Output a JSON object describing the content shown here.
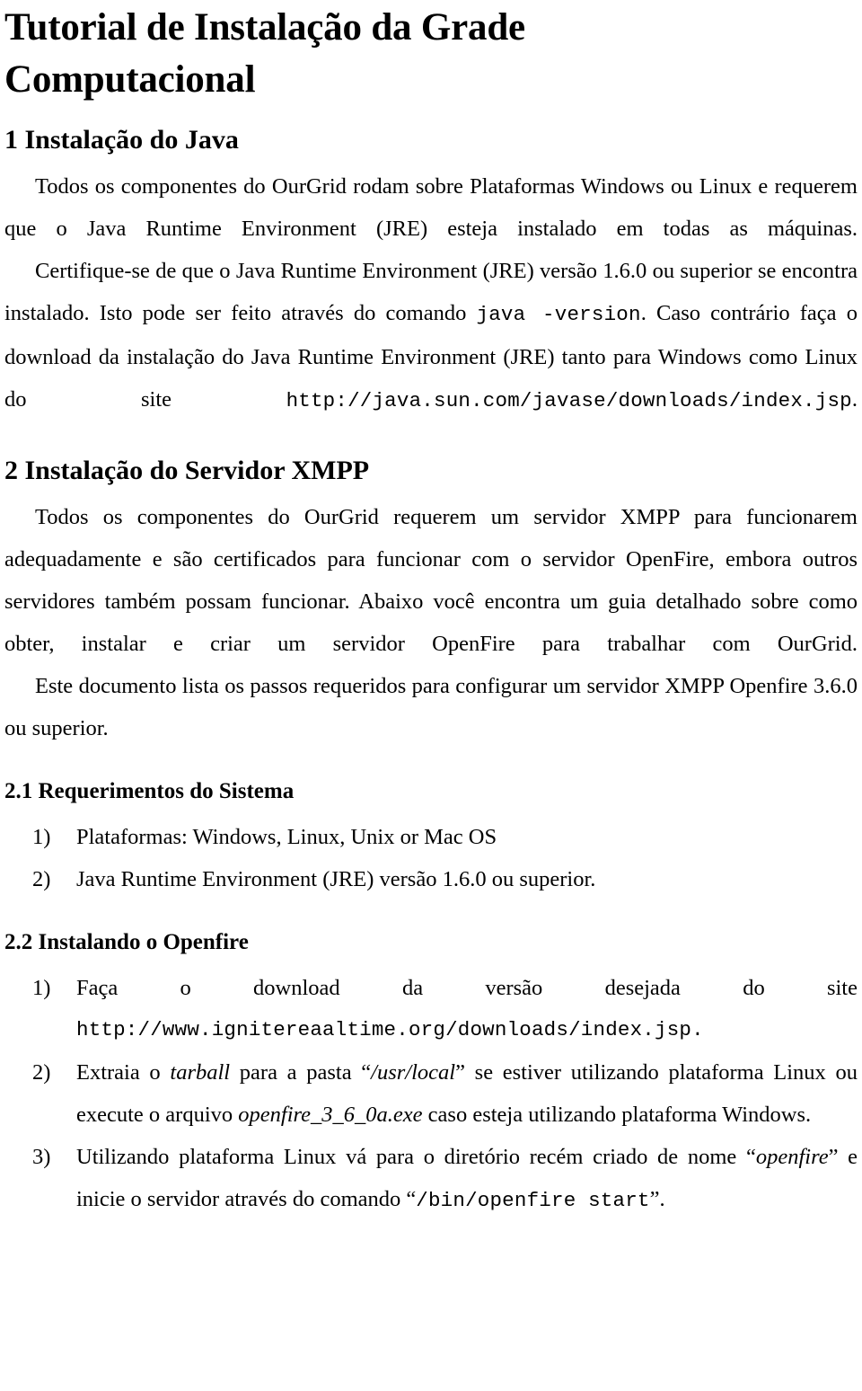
{
  "document": {
    "title": "Tutorial de Instalação da Grade Computacional",
    "language": "pt-BR"
  },
  "sections": [
    {
      "id": "sec-1",
      "heading": "1 Instalação do Java",
      "paragraphs": [
        {
          "id": "p1",
          "text": "Todos os componentes do OurGrid rodam sobre Plataformas Windows ou Linux e requerem que o Java Runtime  Environment (JRE) esteja instalado em todas as máquinas."
        },
        {
          "id": "p2",
          "run_1": "Certifique-se de que o Java Runtime Environment (JRE) versão 1.6.0 ou superior se encontra instalado. Isto pode ser feito através do comando ",
          "code_1": "java -version",
          "run_2": ". Caso contrário faça o download da instalação do Java Runtime  Environment (JRE) tanto para Windows como Linux do site ",
          "code_2": "http://java.sun.com/javase/downloads/index.jsp",
          "run_3": "."
        }
      ]
    },
    {
      "id": "sec-2",
      "heading": "2 Instalação do Servidor XMPP",
      "paragraphs": [
        {
          "id": "p3",
          "text": "Todos os componentes do OurGrid requerem um servidor XMPP para funcionarem adequadamente e são certificados para funcionar com o servidor OpenFire, embora outros servidores também possam funcionar. Abaixo você encontra um guia detalhado sobre como obter, instalar e criar um servidor OpenFire para trabalhar com OurGrid."
        },
        {
          "id": "p4",
          "text": "Este documento lista os passos requeridos para configurar um servidor XMPP Openfire 3.6.0 ou superior."
        }
      ],
      "subsections": [
        {
          "id": "sec-2-1",
          "heading": "2.1 Requerimentos do Sistema",
          "items": [
            {
              "marker": "1)",
              "text": "Plataformas: Windows, Linux, Unix or Mac OS"
            },
            {
              "marker": "2)",
              "text": "Java Runtime Environment (JRE) versão 1.6.0 ou superior."
            }
          ]
        },
        {
          "id": "sec-2-2",
          "heading": "2.2 Instalando o Openfire",
          "items": [
            {
              "marker": "1)",
              "lead": "Faça o download da versão desejada do site",
              "code": "http://www.ignitereaaltime.org/downloads/index.jsp.",
              "code_actual": "http://www.ignitereaaltime.org/downloads/index.jsp."
            },
            {
              "marker": "2)",
              "run_1": "Extraia o ",
              "em_1": "tarball",
              "run_2": " para a pasta “",
              "em_2": "/usr/local",
              "run_3": "” se estiver utilizando plataforma Linux ou execute o arquivo ",
              "em_3": "openfire_3_6_0a.exe",
              "run_4": " caso esteja utilizando plataforma Windows."
            },
            {
              "marker": "3)",
              "run_1": "Utilizando plataforma Linux vá para o diretório recém criado de nome “",
              "em_1": "openfire",
              "run_2": "” e inicie o servidor através do comando “",
              "code_1": "/bin/openfire start",
              "run_3": "”."
            }
          ]
        }
      ]
    }
  ],
  "codes": {
    "java_version": "java -version",
    "java_download_url": "http://java.sun.com/javase/downloads/index.jsp",
    "java_download_url_part1": "http://java.sun.com/javase/downloads/",
    "java_download_url_part2": "index.jsp",
    "openfire_download_url": "http://www.ignitereaaltime.org/downloads/index.jsp.",
    "openfire_start_cmd": "/bin/openfire start"
  }
}
